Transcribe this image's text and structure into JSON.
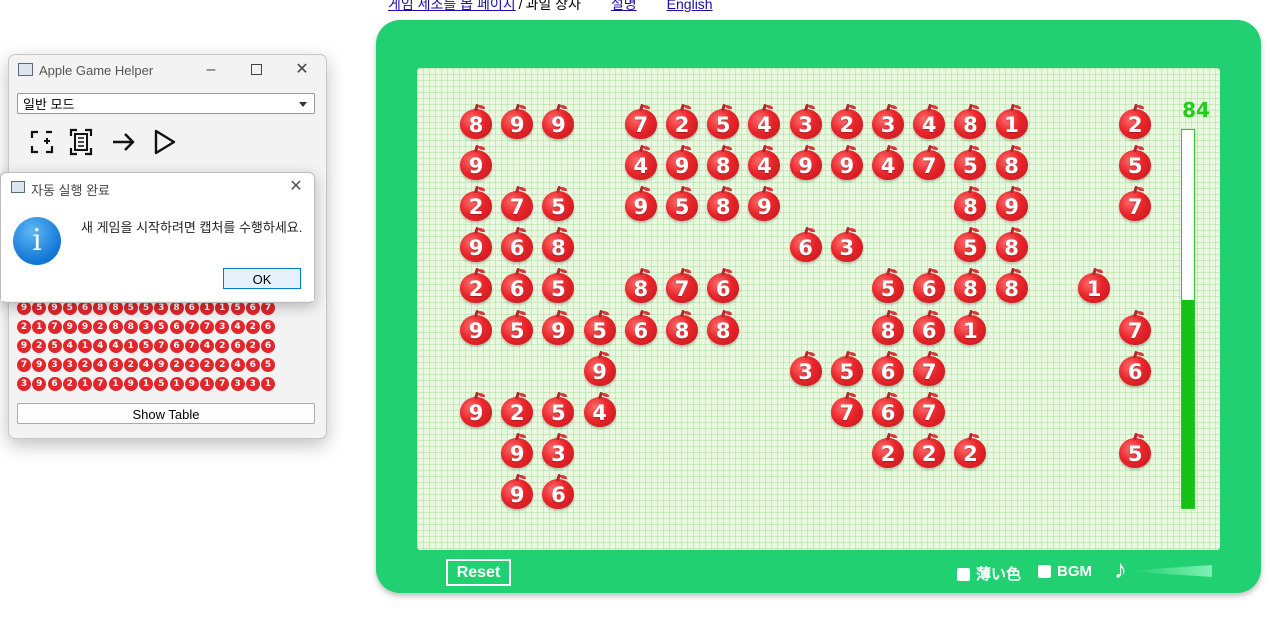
{
  "top_links": {
    "home_link": "게임 세조를 몹 페이지",
    "separator": "/",
    "game_name": "과일 상자",
    "help_link": "설명",
    "english_link": "English"
  },
  "game": {
    "score": "84",
    "time_remaining_fraction": 0.55,
    "reset_label": "Reset",
    "light_color_label": "薄い色",
    "bgm_label": "BGM",
    "rows": [
      [
        "8",
        "9",
        "9",
        "",
        "7",
        "2",
        "5",
        "4",
        "3",
        "2",
        "3",
        "4",
        "8",
        "1",
        "",
        "",
        "2"
      ],
      [
        "9",
        "",
        "",
        "",
        "4",
        "9",
        "8",
        "4",
        "9",
        "9",
        "4",
        "7",
        "5",
        "8",
        "",
        "",
        "5"
      ],
      [
        "2",
        "7",
        "5",
        "",
        "9",
        "5",
        "8",
        "9",
        "",
        "",
        "",
        "",
        "8",
        "9",
        "",
        "",
        "7"
      ],
      [
        "9",
        "6",
        "8",
        "",
        "",
        "",
        "",
        "",
        "6",
        "3",
        "",
        "",
        "5",
        "8",
        "",
        "",
        ""
      ],
      [
        "2",
        "6",
        "5",
        "",
        "8",
        "7",
        "6",
        "",
        "",
        "",
        "5",
        "6",
        "8",
        "8",
        "",
        "1",
        ""
      ],
      [
        "9",
        "5",
        "9",
        "5",
        "6",
        "8",
        "8",
        "",
        "",
        "",
        "8",
        "6",
        "1",
        "",
        "",
        "",
        "7"
      ],
      [
        "",
        "",
        "",
        "9",
        "",
        "",
        "",
        "",
        "3",
        "5",
        "6",
        "7",
        "",
        "",
        "",
        "",
        "6"
      ],
      [
        "9",
        "2",
        "5",
        "4",
        "",
        "",
        "",
        "",
        "",
        "7",
        "6",
        "7",
        "",
        "",
        "",
        "",
        ""
      ],
      [
        "",
        "9",
        "3",
        "",
        "",
        "",
        "",
        "",
        "",
        "",
        "2",
        "2",
        "2",
        "",
        "",
        "",
        "5"
      ],
      [
        "",
        "9",
        "6",
        "",
        "",
        "",
        "",
        "",
        "",
        "",
        "",
        "",
        "",
        "",
        "",
        "",
        ""
      ]
    ]
  },
  "helper": {
    "title": "Apple Game Helper",
    "mode_select": "일반 모드",
    "show_table_label": "Show Table",
    "mini_rows": [
      [
        "9",
        "5",
        "9",
        "5",
        "6",
        "8",
        "8",
        "5",
        "5",
        "3",
        "8",
        "6",
        "1",
        "1",
        "5",
        "6",
        "7"
      ],
      [
        "2",
        "1",
        "7",
        "9",
        "9",
        "2",
        "8",
        "8",
        "3",
        "5",
        "6",
        "7",
        "7",
        "3",
        "4",
        "2",
        "6"
      ],
      [
        "9",
        "2",
        "5",
        "4",
        "1",
        "4",
        "4",
        "1",
        "5",
        "7",
        "6",
        "7",
        "4",
        "2",
        "6",
        "2",
        "6"
      ],
      [
        "7",
        "9",
        "3",
        "3",
        "2",
        "4",
        "3",
        "2",
        "4",
        "9",
        "2",
        "2",
        "2",
        "2",
        "4",
        "6",
        "5"
      ],
      [
        "3",
        "9",
        "6",
        "2",
        "1",
        "7",
        "1",
        "9",
        "1",
        "5",
        "1",
        "9",
        "1",
        "7",
        "3",
        "3",
        "1"
      ]
    ]
  },
  "dialog": {
    "title": "자동 실행 완료",
    "message": "새 게임을 시작하려면 캡처를 수행하세요.",
    "ok_label": "OK",
    "icon_glyph": "i"
  },
  "colors": {
    "frame_green": "#21d070",
    "score_green": "#1ecf1e",
    "apple_red": "#e2262b"
  }
}
